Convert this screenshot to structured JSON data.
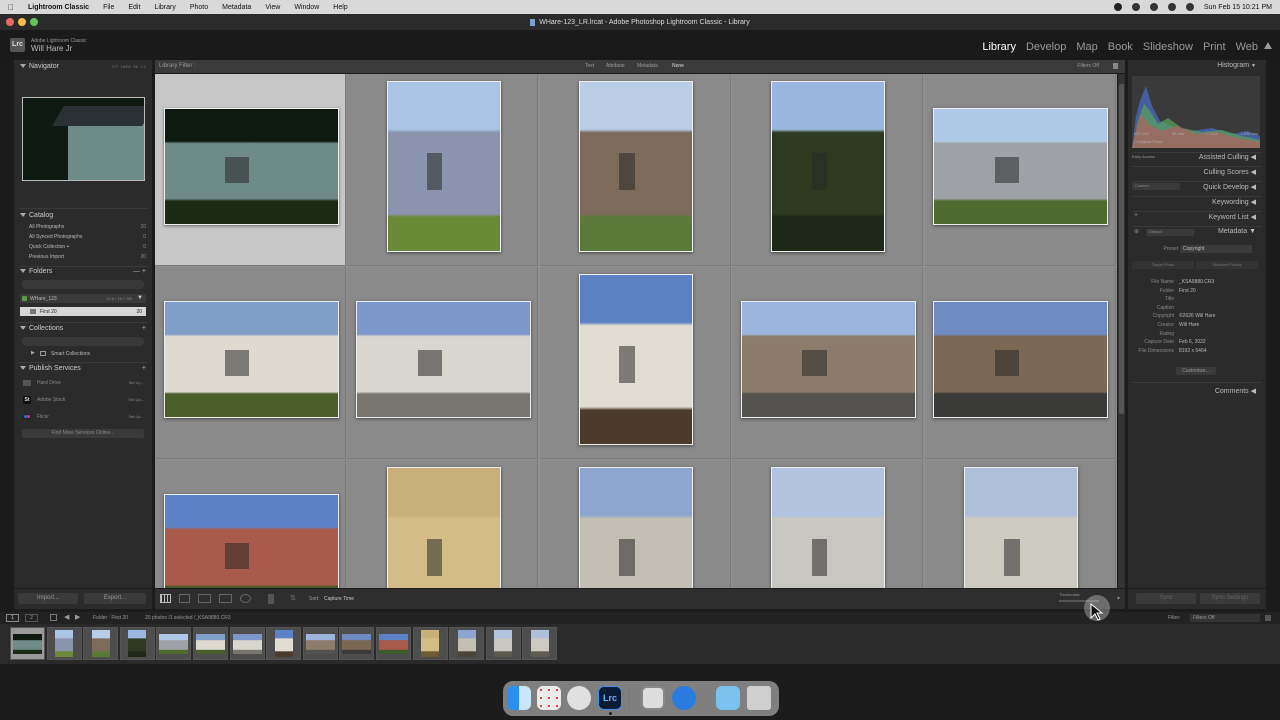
{
  "menubar": {
    "app": "Lightroom Classic",
    "items": [
      "File",
      "Edit",
      "Library",
      "Photo",
      "Metadata",
      "View",
      "Window",
      "Help"
    ],
    "clock": "Sun Feb 15  10:21 PM"
  },
  "window": {
    "title": "WHare-123_LR.lrcat - Adobe Photoshop Lightroom Classic - Library"
  },
  "identity": {
    "logo": "Lrc",
    "subtitle": "Adobe Lightroom Classic",
    "user": "Will Hare Jr"
  },
  "modules": [
    {
      "label": "Library"
    },
    {
      "label": "Develop"
    },
    {
      "label": "Map"
    },
    {
      "label": "Book"
    },
    {
      "label": "Slideshow"
    },
    {
      "label": "Print"
    },
    {
      "label": "Web"
    }
  ],
  "left": {
    "navigator": {
      "title": "Navigator",
      "zoom": [
        "FIT",
        "100%",
        "Fill",
        "1:1"
      ]
    },
    "catalog": {
      "title": "Catalog",
      "items": [
        {
          "label": "All Photographs",
          "count": "20"
        },
        {
          "label": "All Synced Photographs",
          "count": "0"
        },
        {
          "label": "Quick Collection +",
          "count": "0"
        },
        {
          "label": "Previous Import",
          "count": "20"
        }
      ]
    },
    "folders": {
      "title": "Folders",
      "volume": "WHare_123",
      "volume_info": "14.6 / 15.7 GB",
      "folder": "First 20",
      "folder_count": "20"
    },
    "collections": {
      "title": "Collections",
      "item": "Smart Collections"
    },
    "publish": {
      "title": "Publish Services",
      "items": [
        {
          "label": "Hard Drive",
          "action": "Set Up..."
        },
        {
          "label": "Adobe Stock",
          "action": "Set Up..."
        },
        {
          "label": "Flickr",
          "action": "Set Up..."
        }
      ],
      "find_more": "Find More Services Online..."
    },
    "import_label": "Import...",
    "export_label": "Export..."
  },
  "filterbar": {
    "title": "Library Filter :",
    "options": [
      "Text",
      "Attribute",
      "Metadata",
      "None"
    ],
    "filters_off": "Filters Off"
  },
  "right": {
    "histogram": {
      "title": "Histogram",
      "info": [
        "ISO 100",
        "85 mm",
        "f / 5.6",
        "1/250 sec"
      ],
      "original": "Original Photo"
    },
    "panels": [
      {
        "label": "Assisted Culling",
        "tag": "Early Access"
      },
      {
        "label": "Culling Scores",
        "tag": ""
      },
      {
        "label": "Quick Develop",
        "tag": "Custom"
      },
      {
        "label": "Keywording",
        "tag": ""
      },
      {
        "label": "Keyword List",
        "tag": ""
      },
      {
        "label": "Metadata",
        "tag": "Default"
      }
    ],
    "metadata": {
      "preset_label": "Preset",
      "preset_value": "Copyright",
      "target_photo": "Target Photo",
      "selected_photos": "Selected Photos",
      "fields": [
        {
          "label": "File Name",
          "value": "_KSA9880.CR3"
        },
        {
          "label": "Folder",
          "value": "First 20"
        },
        {
          "label": "Title",
          "value": ""
        },
        {
          "label": "Caption",
          "value": ""
        },
        {
          "label": "Copyright",
          "value": "©2026 Will Hare"
        },
        {
          "label": "Creator",
          "value": "Will Hare"
        },
        {
          "label": "Rating",
          "value": ""
        },
        {
          "label": "Capture Date",
          "value": "Feb 6, 2022"
        },
        {
          "label": "File Dimensions",
          "value": "8192 x 5464"
        }
      ],
      "customize": "Customize..."
    },
    "comments": "Comments",
    "sync": "Sync",
    "sync_settings": "Sync Settings"
  },
  "toolbar": {
    "sort_label": "Sort:",
    "sort_value": "Capture Time",
    "thumbnails": "Thumbnails"
  },
  "filmstrip": {
    "pages": [
      "1",
      "2"
    ],
    "source": "Folder : First 20",
    "selection": "20 photos /1 selected /_KSA9880.CR3",
    "filter_label": "Filter:",
    "filter_value": "Filters Off"
  },
  "colors": {
    "accent": "#ffffff",
    "panel": "#2b2b2b",
    "grid": "#8f8f8f",
    "selected_cell": "#c7c7c7"
  },
  "photos": [
    {
      "sky": "#0e1a10",
      "main": "#6f8b88",
      "ground": "#1a2a14",
      "orient": "land"
    },
    {
      "sky": "#a9c4e4",
      "main": "#8a94ad",
      "ground": "#6a8a3a",
      "orient": "port"
    },
    {
      "sky": "#b9cde6",
      "main": "#7d6c5c",
      "ground": "#5b7a3a",
      "orient": "port"
    },
    {
      "sky": "#9ab8df",
      "main": "#2d3a1f",
      "ground": "#1e2816",
      "orient": "port"
    },
    {
      "sky": "#b0c8e8",
      "main": "#9ea2a6",
      "ground": "#4f6a2e",
      "orient": "land"
    },
    {
      "sky": "#7f9ec8",
      "main": "#dedad0",
      "ground": "#4a5e2a",
      "orient": "land"
    },
    {
      "sky": "#7c97c9",
      "main": "#d9d6cf",
      "ground": "#77756e",
      "orient": "land"
    },
    {
      "sky": "#5d82c4",
      "main": "#e2ddd2",
      "ground": "#4a3b2b",
      "orient": "port"
    },
    {
      "sky": "#9bb5dc",
      "main": "#8c7c6b",
      "ground": "#54524f",
      "orient": "land"
    },
    {
      "sky": "#6f8cc2",
      "main": "#7a6754",
      "ground": "#3a3a38",
      "orient": "land"
    },
    {
      "sky": "#5d82c7",
      "main": "#aa5a4a",
      "ground": "#3d5a2b",
      "orient": "land"
    },
    {
      "sky": "#c9b078",
      "main": "#d3bc86",
      "ground": "#6e5b35",
      "orient": "port"
    },
    {
      "sky": "#8ea6cf",
      "main": "#c4bfb5",
      "ground": "#4a4538",
      "orient": "port"
    },
    {
      "sky": "#b1c3df",
      "main": "#c8c6c0",
      "ground": "#5a5a50",
      "orient": "port"
    },
    {
      "sky": "#b0bfd8",
      "main": "#cdcac2",
      "ground": "#605a50",
      "orient": "port"
    }
  ]
}
